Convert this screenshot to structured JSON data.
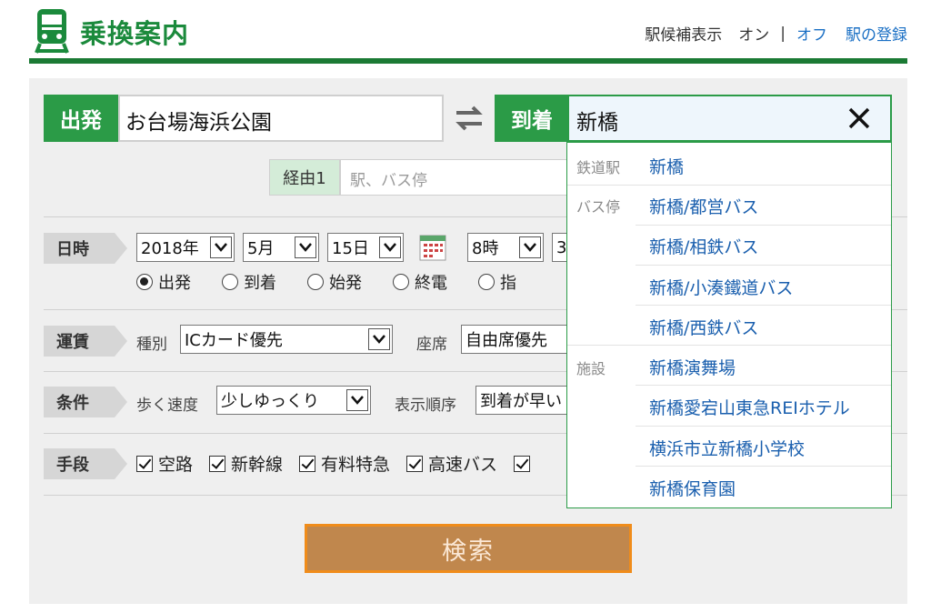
{
  "header": {
    "title": "乗換案内",
    "nav_suggest_label": "駅候補表示",
    "nav_on": "オン",
    "nav_sep": "|",
    "nav_off": "オフ",
    "nav_register": "駅の登録"
  },
  "route": {
    "departure_label": "出発",
    "departure_value": "お台場海浜公園",
    "arrival_label": "到着",
    "arrival_value": "新橋",
    "via_label": "経由1",
    "via_placeholder": "駅、バス停"
  },
  "datetime": {
    "label": "日時",
    "year": "2018年",
    "month": "5月",
    "day": "15日",
    "hour": "8時",
    "minute_partial": "3",
    "modes": [
      "出発",
      "到着",
      "始発",
      "終電",
      "指"
    ],
    "selected_mode": "出発"
  },
  "fare": {
    "label": "運賃",
    "type_label": "種別",
    "type_value": "ICカード優先",
    "seat_label": "座席",
    "seat_value": "自由席優先"
  },
  "conditions": {
    "label": "条件",
    "walk_label": "歩く速度",
    "walk_value": "少しゆっくり",
    "order_label": "表示順序",
    "order_value": "到着が早い"
  },
  "means": {
    "label": "手段",
    "options": [
      "空路",
      "新幹線",
      "有料特急",
      "高速バス"
    ]
  },
  "search_button": "検索",
  "suggestions": {
    "station_category": "鉄道駅",
    "station_items": [
      "新橋"
    ],
    "bus_category": "バス停",
    "bus_items": [
      "新橋/都営バス",
      "新橋/相鉄バス",
      "新橋/小湊鐵道バス",
      "新橋/西鉄バス"
    ],
    "facility_category": "施設",
    "facility_items": [
      "新橋演舞場",
      "新橋愛宕山東急REIホテル",
      "横浜市立新橋小学校",
      "新橋保育園"
    ]
  },
  "colors": {
    "brand_green": "#2b9b47",
    "link_blue": "#1a5fae",
    "search_button": "#c0874d",
    "search_border": "#f08c1a"
  }
}
